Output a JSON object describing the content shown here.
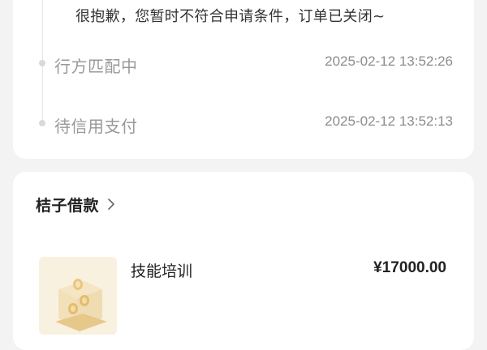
{
  "status_card": {
    "message": "很抱歉，您暂时不符合申请条件，订单已关闭~",
    "timeline": [
      {
        "label": "行方匹配中",
        "time": "2025-02-12 13:52:26"
      },
      {
        "label": "待信用支付",
        "time": "2025-02-12 13:52:13"
      }
    ]
  },
  "product_card": {
    "merchant": "桔子借款",
    "merchant_chevron_icon": "chevron-right-icon",
    "product": {
      "title": "技能培训",
      "price": "¥17000.00",
      "thumbnail_icon": "coin-box-icon"
    }
  }
}
